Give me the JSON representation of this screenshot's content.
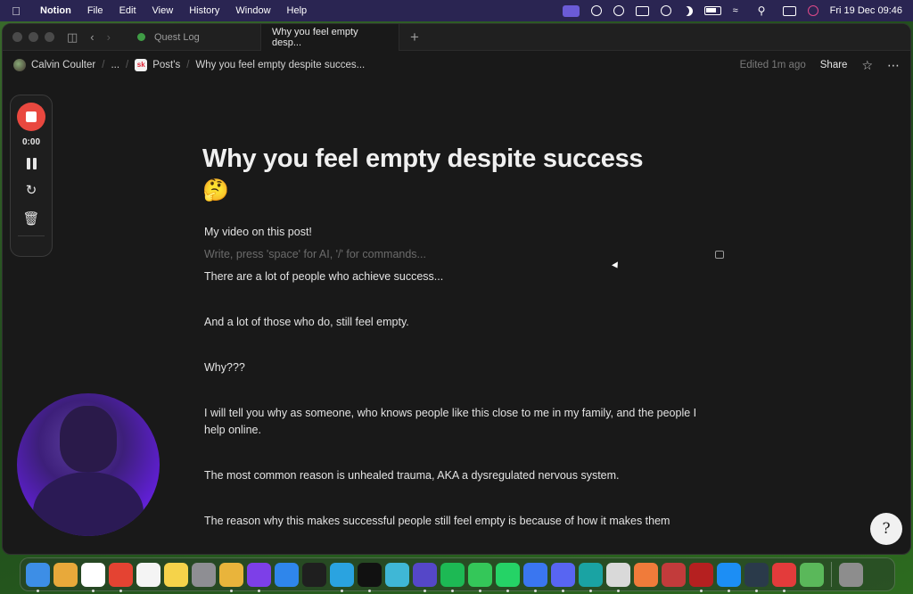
{
  "menubar": {
    "app_name": "Notion",
    "menus": [
      "File",
      "Edit",
      "View",
      "History",
      "Window",
      "Help"
    ],
    "clock": "Fri 19 Dec  09:46"
  },
  "tabs": [
    {
      "label": "Quest Log"
    },
    {
      "label": "Why you feel empty desp..."
    }
  ],
  "breadcrumb": {
    "workspace": "Calvin Coulter",
    "ellipsis": "...",
    "parent_badge": "sk",
    "parent": "Post's",
    "current": "Why you feel empty despite succes..."
  },
  "topbar": {
    "edited": "Edited 1m ago",
    "share": "Share"
  },
  "recorder": {
    "time": "0:00"
  },
  "page": {
    "title": "Why you feel empty despite success",
    "emoji": "🤔",
    "blocks": [
      "My video on this post!",
      "Write, press 'space' for AI, '/' for commands...",
      "There are a lot of people who achieve success...",
      "And a lot of those who do, still feel empty.",
      "Why???",
      "I will tell you why as someone, who knows people like this close to me in my family, and the people I help online.",
      "The most common reason is unhealed trauma, AKA a dysregulated nervous system.",
      "The reason why this makes successful people still feel empty is because of how it makes them"
    ]
  },
  "colors": {
    "record_red": "#e9483f",
    "window_bg": "#191919",
    "menubar_bg": "#2a2552"
  },
  "dock": [
    {
      "name": "finder-icon",
      "color": "#3d8ee6"
    },
    {
      "name": "launchpad-icon",
      "color": "#e8a93a"
    },
    {
      "name": "notion-icon",
      "color": "#ffffff"
    },
    {
      "name": "todoist-icon",
      "color": "#e44332"
    },
    {
      "name": "reminders-icon",
      "color": "#f4f4f4"
    },
    {
      "name": "notes-icon",
      "color": "#f5d34a"
    },
    {
      "name": "system-settings-icon",
      "color": "#8e8e93"
    },
    {
      "name": "chrome-icon",
      "color": "#e9b43b"
    },
    {
      "name": "arc-icon",
      "color": "#7d3fe8"
    },
    {
      "name": "safari-icon",
      "color": "#2f86eb"
    },
    {
      "name": "voice-memos-icon",
      "color": "#1f1f1f"
    },
    {
      "name": "telegram-icon",
      "color": "#2aa3e0"
    },
    {
      "name": "capcut-icon",
      "color": "#111111"
    },
    {
      "name": "canva-icon",
      "color": "#3fb7d6"
    },
    {
      "name": "vpn-icon",
      "color": "#5547c8"
    },
    {
      "name": "spotify-icon",
      "color": "#1db954"
    },
    {
      "name": "messages-icon",
      "color": "#34c759"
    },
    {
      "name": "whatsapp-icon",
      "color": "#25d366"
    },
    {
      "name": "signal-icon",
      "color": "#3a76f0"
    },
    {
      "name": "discord-icon",
      "color": "#5865f2"
    },
    {
      "name": "surfshark-icon",
      "color": "#1aa3a3"
    },
    {
      "name": "finch-icon",
      "color": "#d9d9d9"
    },
    {
      "name": "photos-icon",
      "color": "#f07b3a"
    },
    {
      "name": "photo-booth-icon",
      "color": "#c23b3b"
    },
    {
      "name": "quill-icon",
      "color": "#b52020"
    },
    {
      "name": "app-store-icon",
      "color": "#1c8ef5"
    },
    {
      "name": "screen-studio-icon",
      "color": "#2a3a4a"
    },
    {
      "name": "presentation-icon",
      "color": "#e33b3b"
    },
    {
      "name": "preview-icon",
      "color": "#5ab85a"
    },
    {
      "name": "trash-icon",
      "color": "#8d8d8d"
    }
  ]
}
